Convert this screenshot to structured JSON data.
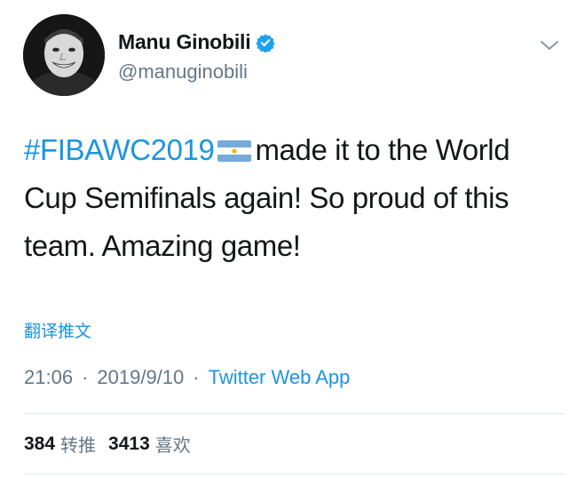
{
  "user": {
    "display_name": "Manu Ginobili",
    "handle": "@manuginobili",
    "verified": true
  },
  "tweet": {
    "hashtag": "#FIBAWC2019",
    "flag_icon": "argentina-flag-icon",
    "text": "made it to the World Cup Semifinals again! So proud of this team. Amazing game!",
    "translate_label": "翻译推文"
  },
  "meta": {
    "time": "21:06",
    "date": "2019/9/10",
    "separator": "·",
    "source": "Twitter Web App"
  },
  "stats": {
    "retweets_count": "384",
    "retweets_label": "转推",
    "likes_count": "3413",
    "likes_label": "喜欢"
  },
  "colors": {
    "link": "#1b95e0",
    "secondary_text": "#657786",
    "primary_text": "#14171a",
    "divider": "#e1e8ed"
  }
}
